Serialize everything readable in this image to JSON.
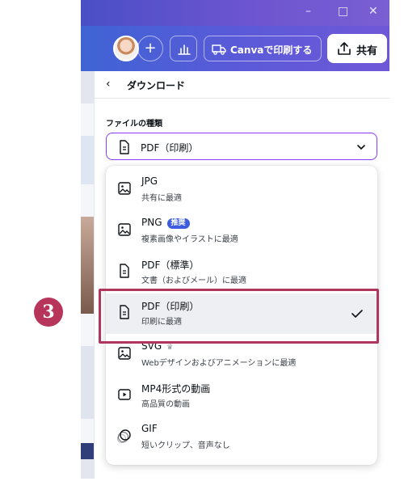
{
  "window": {
    "controls": {
      "minimize": "–",
      "maximize": "□",
      "close": "✕"
    }
  },
  "toolbar": {
    "add_label": "+",
    "print_label": "Canvaで印刷する",
    "share_label": "共有"
  },
  "panel": {
    "title": "ダウンロード",
    "back_icon": "chevron-left-icon",
    "file_type_label": "ファイルの種類",
    "selected_file_type": "PDF（印刷）"
  },
  "dropdown": {
    "options": [
      {
        "name": "JPG",
        "desc": "共有に最適",
        "icon": "image-icon"
      },
      {
        "name": "PNG",
        "desc": "複素画像やイラストに最適",
        "icon": "image-icon",
        "badge": "推奨"
      },
      {
        "name": "PDF（標準）",
        "desc": "文書（およびメール）に最適",
        "icon": "document-icon"
      },
      {
        "name": "PDF（印刷）",
        "desc": "印刷に最適",
        "icon": "document-icon",
        "selected": true
      },
      {
        "name": "SVG",
        "desc": "Webデザインおよびアニメーションに最適",
        "icon": "image-icon",
        "crown": "♛"
      },
      {
        "name": "MP4形式の動画",
        "desc": "高品質の動画",
        "icon": "video-icon"
      },
      {
        "name": "GIF",
        "desc": "短いクリップ、音声なし",
        "icon": "gif-icon"
      }
    ]
  },
  "annotation": {
    "step_number": "3",
    "color": "#b7345b"
  },
  "colors": {
    "accent": "#8b3dff",
    "header_gradient_start": "#4a4fc6",
    "badge_blue": "#3d5ce0"
  }
}
